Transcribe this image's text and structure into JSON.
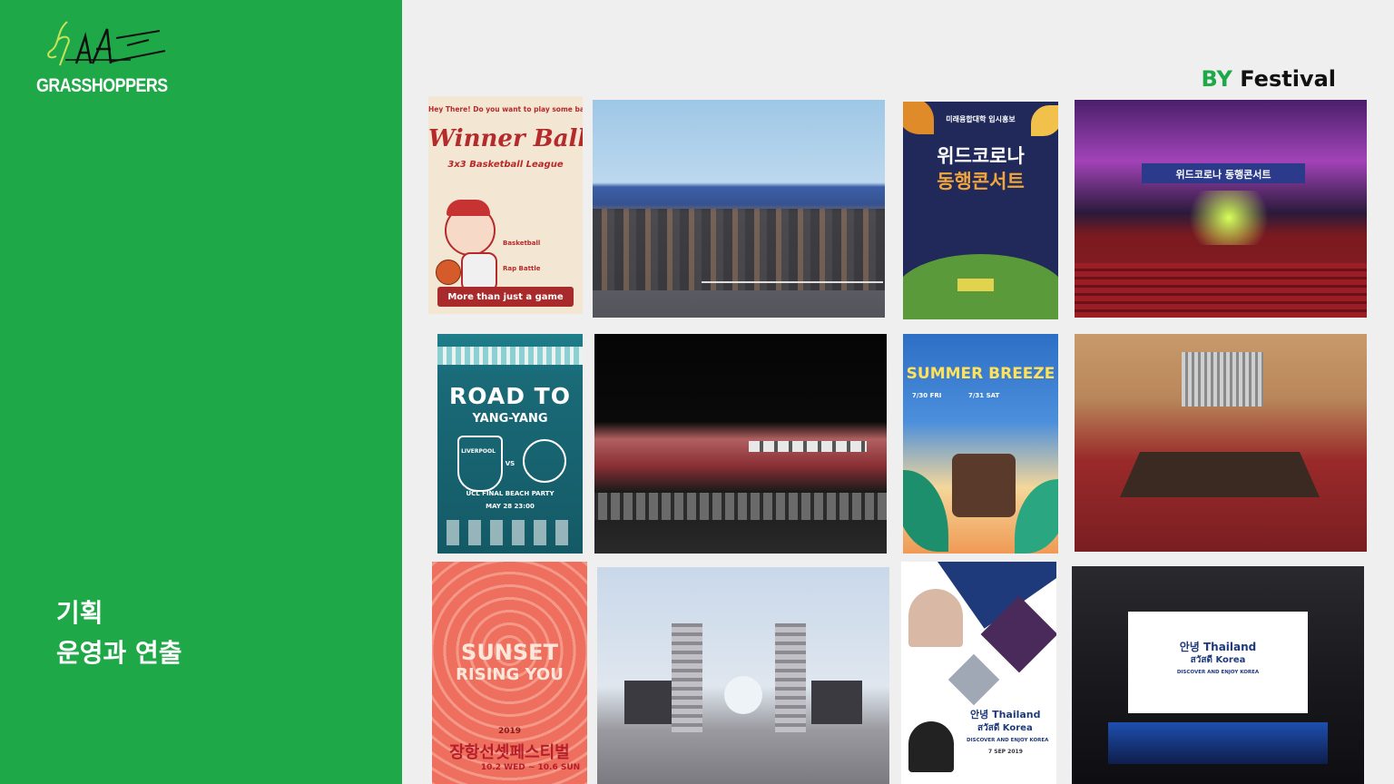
{
  "brand": {
    "name": "GRASSHOPPERS",
    "logo_icon": "grasshoppers-logo-icon"
  },
  "tagline": {
    "line1": "기획",
    "line2": "운영과 연출"
  },
  "section": {
    "prefix": "BY",
    "title": "Festival"
  },
  "colors": {
    "brand_green": "#1fa847",
    "background": "#efefef"
  },
  "gallery": {
    "winner_ball": {
      "top_line": "Hey There! Do you want to play some ball?",
      "title": "Winner Ball",
      "subtitle": "3x3 Basketball League",
      "label1": "Basketball",
      "label2": "Rap Battle",
      "banner": "More than just a game"
    },
    "road_to_yangyang": {
      "title": "ROAD TO",
      "subtitle": "YANG-YANG",
      "team1": "LIVERPOOL",
      "vs": "VS",
      "event": "UCL FINAL BEACH PARTY",
      "date": "MAY 28 23:00"
    },
    "with_corona_poster": {
      "top": "미래융합대학 입시홍보",
      "title_line1": "위드코로나",
      "title_line2": "동행콘서트"
    },
    "concert_hall_banner": "위드코로나 동행콘서트",
    "summer_breeze": {
      "title": "SUMMER BREEZE",
      "d1": "7/30 FRI",
      "d2": "7/31 SAT"
    },
    "sunset_rising": {
      "title1": "SUNSET",
      "title2": "RISING YOU",
      "year": "2019",
      "title_ko": "장항선셋페스티벌",
      "dates": "10.2 WED ~ 10.6 SUN"
    },
    "thailand_korea": {
      "title_line1": "안녕 Thailand",
      "title_line2": "สวัสดี Korea",
      "sub": "DISCOVER AND ENJOY KOREA",
      "date": "7 SEP 2019"
    }
  }
}
